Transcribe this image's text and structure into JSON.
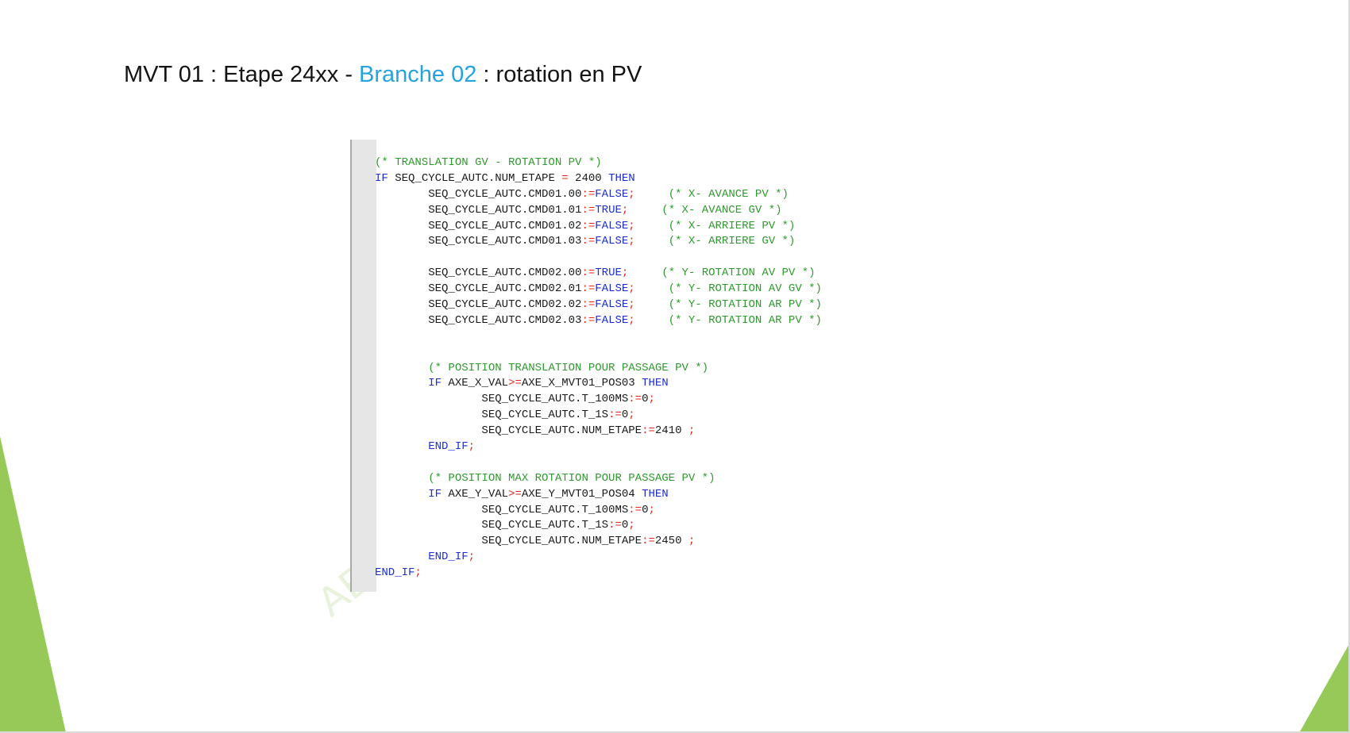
{
  "slide": {
    "title_prefix": "MVT 01 : Etape 24xx - ",
    "title_accent": "Branche 02",
    "title_suffix": " : rotation en PV"
  },
  "colors": {
    "accent": "#26a3dc",
    "keyword": "#1c2dd4",
    "comment": "#2f9a2f",
    "operator": "#e0281e",
    "decor_green": "#96c957"
  },
  "watermark": "AB",
  "code": {
    "lines": [
      [
        {
          "c": "cmt",
          "t": "(* TRANSLATION GV - ROTATION PV *)"
        }
      ],
      [
        {
          "c": "kw",
          "t": "IF"
        },
        {
          "c": "",
          "t": " SEQ_CYCLE_AUTC.NUM_ETAPE "
        },
        {
          "c": "op",
          "t": "="
        },
        {
          "c": "",
          "t": " 2400 "
        },
        {
          "c": "kw",
          "t": "THEN"
        }
      ],
      [
        {
          "c": "",
          "t": "        SEQ_CYCLE_AUTC.CMD01.00"
        },
        {
          "c": "op",
          "t": ":="
        },
        {
          "c": "bool",
          "t": "FALSE"
        },
        {
          "c": "op",
          "t": ";"
        },
        {
          "c": "",
          "t": "     "
        },
        {
          "c": "cmt",
          "t": "(* X- AVANCE PV *)"
        }
      ],
      [
        {
          "c": "",
          "t": "        SEQ_CYCLE_AUTC.CMD01.01"
        },
        {
          "c": "op",
          "t": ":="
        },
        {
          "c": "bool",
          "t": "TRUE"
        },
        {
          "c": "op",
          "t": ";"
        },
        {
          "c": "",
          "t": "     "
        },
        {
          "c": "cmt",
          "t": "(* X- AVANCE GV *)"
        }
      ],
      [
        {
          "c": "",
          "t": "        SEQ_CYCLE_AUTC.CMD01.02"
        },
        {
          "c": "op",
          "t": ":="
        },
        {
          "c": "bool",
          "t": "FALSE"
        },
        {
          "c": "op",
          "t": ";"
        },
        {
          "c": "",
          "t": "     "
        },
        {
          "c": "cmt",
          "t": "(* X- ARRIERE PV *)"
        }
      ],
      [
        {
          "c": "",
          "t": "        SEQ_CYCLE_AUTC.CMD01.03"
        },
        {
          "c": "op",
          "t": ":="
        },
        {
          "c": "bool",
          "t": "FALSE"
        },
        {
          "c": "op",
          "t": ";"
        },
        {
          "c": "",
          "t": "     "
        },
        {
          "c": "cmt",
          "t": "(* X- ARRIERE GV *)"
        }
      ],
      [
        {
          "c": "",
          "t": ""
        }
      ],
      [
        {
          "c": "",
          "t": "        SEQ_CYCLE_AUTC.CMD02.00"
        },
        {
          "c": "op",
          "t": ":="
        },
        {
          "c": "bool",
          "t": "TRUE"
        },
        {
          "c": "op",
          "t": ";"
        },
        {
          "c": "",
          "t": "     "
        },
        {
          "c": "cmt",
          "t": "(* Y- ROTATION AV PV *)"
        }
      ],
      [
        {
          "c": "",
          "t": "        SEQ_CYCLE_AUTC.CMD02.01"
        },
        {
          "c": "op",
          "t": ":="
        },
        {
          "c": "bool",
          "t": "FALSE"
        },
        {
          "c": "op",
          "t": ";"
        },
        {
          "c": "",
          "t": "     "
        },
        {
          "c": "cmt",
          "t": "(* Y- ROTATION AV GV *)"
        }
      ],
      [
        {
          "c": "",
          "t": "        SEQ_CYCLE_AUTC.CMD02.02"
        },
        {
          "c": "op",
          "t": ":="
        },
        {
          "c": "bool",
          "t": "FALSE"
        },
        {
          "c": "op",
          "t": ";"
        },
        {
          "c": "",
          "t": "     "
        },
        {
          "c": "cmt",
          "t": "(* Y- ROTATION AR PV *)"
        }
      ],
      [
        {
          "c": "",
          "t": "        SEQ_CYCLE_AUTC.CMD02.03"
        },
        {
          "c": "op",
          "t": ":="
        },
        {
          "c": "bool",
          "t": "FALSE"
        },
        {
          "c": "op",
          "t": ";"
        },
        {
          "c": "",
          "t": "     "
        },
        {
          "c": "cmt",
          "t": "(* Y- ROTATION AR PV *)"
        }
      ],
      [
        {
          "c": "",
          "t": ""
        }
      ],
      [
        {
          "c": "",
          "t": ""
        }
      ],
      [
        {
          "c": "",
          "t": "        "
        },
        {
          "c": "cmt",
          "t": "(* POSITION TRANSLATION POUR PASSAGE PV *)"
        }
      ],
      [
        {
          "c": "",
          "t": "        "
        },
        {
          "c": "kw",
          "t": "IF"
        },
        {
          "c": "",
          "t": " AXE_X_VAL"
        },
        {
          "c": "op",
          "t": ">="
        },
        {
          "c": "",
          "t": "AXE_X_MVT01_POS03 "
        },
        {
          "c": "kw",
          "t": "THEN"
        }
      ],
      [
        {
          "c": "",
          "t": "                SEQ_CYCLE_AUTC.T_100MS"
        },
        {
          "c": "op",
          "t": ":="
        },
        {
          "c": "",
          "t": "0"
        },
        {
          "c": "op",
          "t": ";"
        }
      ],
      [
        {
          "c": "",
          "t": "                SEQ_CYCLE_AUTC.T_1S"
        },
        {
          "c": "op",
          "t": ":="
        },
        {
          "c": "",
          "t": "0"
        },
        {
          "c": "op",
          "t": ";"
        }
      ],
      [
        {
          "c": "",
          "t": "                SEQ_CYCLE_AUTC.NUM_ETAPE"
        },
        {
          "c": "op",
          "t": ":="
        },
        {
          "c": "",
          "t": "2410 "
        },
        {
          "c": "op",
          "t": ";"
        }
      ],
      [
        {
          "c": "",
          "t": "        "
        },
        {
          "c": "kw",
          "t": "END_IF"
        },
        {
          "c": "op",
          "t": ";"
        }
      ],
      [
        {
          "c": "",
          "t": ""
        }
      ],
      [
        {
          "c": "",
          "t": "        "
        },
        {
          "c": "cmt",
          "t": "(* POSITION MAX ROTATION POUR PASSAGE PV *)"
        }
      ],
      [
        {
          "c": "",
          "t": "        "
        },
        {
          "c": "kw",
          "t": "IF"
        },
        {
          "c": "",
          "t": " AXE_Y_VAL"
        },
        {
          "c": "op",
          "t": ">="
        },
        {
          "c": "",
          "t": "AXE_Y_MVT01_POS04 "
        },
        {
          "c": "kw",
          "t": "THEN"
        }
      ],
      [
        {
          "c": "",
          "t": "                SEQ_CYCLE_AUTC.T_100MS"
        },
        {
          "c": "op",
          "t": ":="
        },
        {
          "c": "",
          "t": "0"
        },
        {
          "c": "op",
          "t": ";"
        }
      ],
      [
        {
          "c": "",
          "t": "                SEQ_CYCLE_AUTC.T_1S"
        },
        {
          "c": "op",
          "t": ":="
        },
        {
          "c": "",
          "t": "0"
        },
        {
          "c": "op",
          "t": ";"
        }
      ],
      [
        {
          "c": "",
          "t": "                SEQ_CYCLE_AUTC.NUM_ETAPE"
        },
        {
          "c": "op",
          "t": ":="
        },
        {
          "c": "",
          "t": "2450 "
        },
        {
          "c": "op",
          "t": ";"
        }
      ],
      [
        {
          "c": "",
          "t": "        "
        },
        {
          "c": "kw",
          "t": "END_IF"
        },
        {
          "c": "op",
          "t": ";"
        }
      ],
      [
        {
          "c": "kw",
          "t": "END_IF"
        },
        {
          "c": "op",
          "t": ";"
        }
      ]
    ]
  }
}
